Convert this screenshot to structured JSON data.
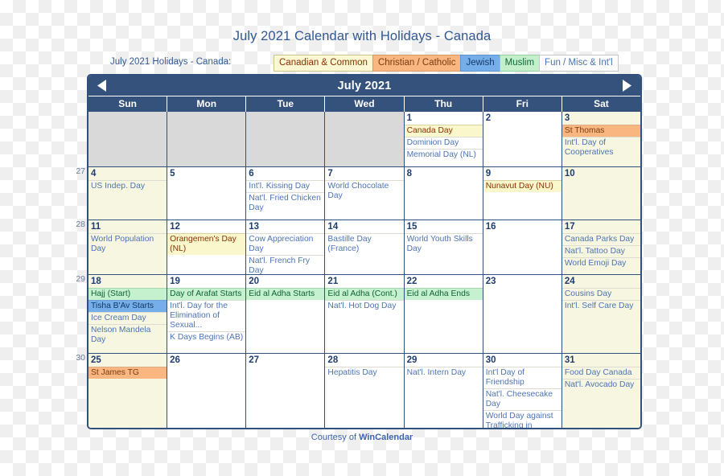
{
  "title": "July 2021 Calendar with Holidays - Canada",
  "legend": {
    "caption": "July 2021 Holidays - Canada:",
    "chips": [
      {
        "label": "Canadian & Common",
        "key": "canadian",
        "bg": "#fcf8d4",
        "fg": "#8b2f00"
      },
      {
        "label": "Christian / Catholic",
        "key": "christian",
        "bg": "#f9b680",
        "fg": "#7a3b10"
      },
      {
        "label": "Jewish",
        "key": "jewish",
        "bg": "#76aeea",
        "fg": "#123a66"
      },
      {
        "label": "Muslim",
        "key": "muslim",
        "bg": "#c3f0cb",
        "fg": "#11663a"
      },
      {
        "label": "Fun / Misc & Int'l",
        "key": "fun",
        "bg": "#fdfdfd",
        "fg": "#4d74b5"
      }
    ]
  },
  "calendar": {
    "month_label": "July 2021",
    "prev_label": "Previous month",
    "next_label": "Next month",
    "weekdays": [
      "Sun",
      "Mon",
      "Tue",
      "Wed",
      "Thu",
      "Fri",
      "Sat"
    ],
    "week_numbers": [
      "",
      "27",
      "28",
      "29",
      "30"
    ],
    "weeks": [
      [
        {
          "day": "",
          "blank": true,
          "events": []
        },
        {
          "day": "",
          "blank": true,
          "events": []
        },
        {
          "day": "",
          "blank": true,
          "events": []
        },
        {
          "day": "",
          "blank": true,
          "events": []
        },
        {
          "day": "1",
          "events": [
            {
              "text": "Canada Day",
              "type": "canadian"
            },
            {
              "text": "Dominion Day",
              "type": "plain"
            },
            {
              "text": "Memorial Day (NL)",
              "type": "plain"
            }
          ]
        },
        {
          "day": "2",
          "events": []
        },
        {
          "day": "3",
          "events": [
            {
              "text": "St Thomas",
              "type": "christian"
            },
            {
              "text": "Int'l. Day of Cooperatives",
              "type": "plain"
            }
          ]
        }
      ],
      [
        {
          "day": "4",
          "events": [
            {
              "text": "US Indep. Day",
              "type": "plain"
            }
          ]
        },
        {
          "day": "5",
          "events": []
        },
        {
          "day": "6",
          "events": [
            {
              "text": "Int'l. Kissing Day",
              "type": "plain"
            },
            {
              "text": "Nat'l. Fried Chicken Day",
              "type": "plain"
            }
          ]
        },
        {
          "day": "7",
          "events": [
            {
              "text": "World Chocolate Day",
              "type": "plain"
            }
          ]
        },
        {
          "day": "8",
          "events": []
        },
        {
          "day": "9",
          "events": [
            {
              "text": "Nunavut Day (NU)",
              "type": "canadian"
            }
          ]
        },
        {
          "day": "10",
          "events": []
        }
      ],
      [
        {
          "day": "11",
          "events": [
            {
              "text": "World Population Day",
              "type": "plain"
            }
          ]
        },
        {
          "day": "12",
          "events": [
            {
              "text": "Orangemen's Day (NL)",
              "type": "canadian"
            }
          ]
        },
        {
          "day": "13",
          "events": [
            {
              "text": "Cow Appreciation Day",
              "type": "plain"
            },
            {
              "text": "Nat'l. French Fry Day",
              "type": "plain"
            }
          ]
        },
        {
          "day": "14",
          "events": [
            {
              "text": "Bastille Day (France)",
              "type": "plain"
            }
          ]
        },
        {
          "day": "15",
          "events": [
            {
              "text": "World Youth Skills Day",
              "type": "plain"
            }
          ]
        },
        {
          "day": "16",
          "events": []
        },
        {
          "day": "17",
          "events": [
            {
              "text": "Canada Parks Day",
              "type": "plain"
            },
            {
              "text": "Nat'l. Tattoo Day",
              "type": "plain"
            },
            {
              "text": "World Emoji Day",
              "type": "plain"
            }
          ]
        }
      ],
      [
        {
          "day": "18",
          "events": [
            {
              "text": "Hajj (Start)",
              "type": "muslim"
            },
            {
              "text": "Tisha B'Av Starts",
              "type": "jewish"
            },
            {
              "text": "Ice Cream Day",
              "type": "plain"
            },
            {
              "text": "Nelson Mandela Day",
              "type": "plain"
            }
          ]
        },
        {
          "day": "19",
          "events": [
            {
              "text": "Day of Arafat Starts",
              "type": "muslim"
            },
            {
              "text": "Int'l. Day for the Elimination of Sexual...",
              "type": "plain"
            },
            {
              "text": "K Days Begins (AB)",
              "type": "plain"
            }
          ]
        },
        {
          "day": "20",
          "events": [
            {
              "text": "Eid al Adha Starts",
              "type": "muslim"
            }
          ]
        },
        {
          "day": "21",
          "events": [
            {
              "text": "Eid al Adha (Cont.)",
              "type": "muslim"
            },
            {
              "text": "Nat'l. Hot Dog Day",
              "type": "plain"
            }
          ]
        },
        {
          "day": "22",
          "events": [
            {
              "text": "Eid al Adha Ends",
              "type": "muslim"
            }
          ]
        },
        {
          "day": "23",
          "events": []
        },
        {
          "day": "24",
          "events": [
            {
              "text": "Cousins Day",
              "type": "plain"
            },
            {
              "text": "Int'l. Self Care Day",
              "type": "plain"
            }
          ]
        }
      ],
      [
        {
          "day": "25",
          "events": [
            {
              "text": "St James TG",
              "type": "christian"
            }
          ]
        },
        {
          "day": "26",
          "events": []
        },
        {
          "day": "27",
          "events": []
        },
        {
          "day": "28",
          "events": [
            {
              "text": "Hepatitis Day",
              "type": "plain"
            }
          ]
        },
        {
          "day": "29",
          "events": [
            {
              "text": "Nat'l. Intern Day",
              "type": "plain"
            }
          ]
        },
        {
          "day": "30",
          "events": [
            {
              "text": "Int'l Day of Friendship",
              "type": "plain"
            },
            {
              "text": "Nat'l. Cheesecake Day",
              "type": "plain"
            },
            {
              "text": "World Day against Trafficking in Persons",
              "type": "plain"
            }
          ]
        },
        {
          "day": "31",
          "events": [
            {
              "text": "Food Day Canada",
              "type": "plain"
            },
            {
              "text": "Nat'l. Avocado Day",
              "type": "plain"
            }
          ]
        }
      ]
    ]
  },
  "footer": {
    "prefix": "Courtesy of ",
    "brand": "WinCalendar"
  }
}
